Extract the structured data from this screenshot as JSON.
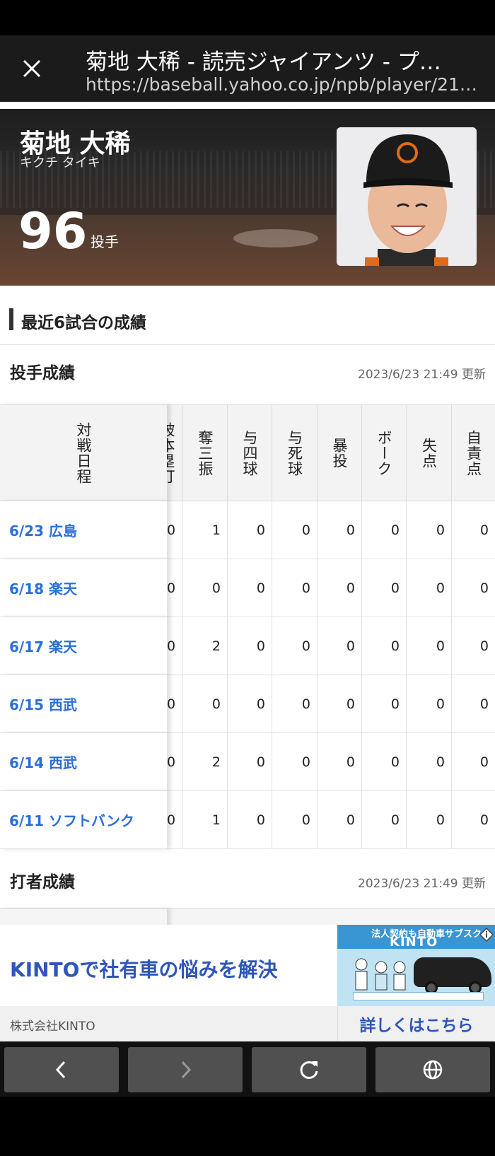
{
  "browser": {
    "title": "菊地 大稀 - 読売ジャイアンツ - プ…",
    "url": "https://baseball.yahoo.co.jp/npb/player/21…"
  },
  "player": {
    "name": "菊地 大稀",
    "kana": "キクチ タイキ",
    "number": "96",
    "position": "投手"
  },
  "section": {
    "title": "最近6試合の成績"
  },
  "pitching": {
    "title": "投手成績",
    "updated": "2023/6/23 21:49 更新",
    "date_header": "対戦日程",
    "partial_header": "被本塁打",
    "columns": [
      "奪三振",
      "与四球",
      "与死球",
      "暴投",
      "ボーク",
      "失点",
      "自責点"
    ],
    "rows": [
      {
        "date": "6/23 広島",
        "partial": "0",
        "values": [
          "1",
          "0",
          "0",
          "0",
          "0",
          "0",
          "0"
        ]
      },
      {
        "date": "6/18 楽天",
        "partial": "0",
        "values": [
          "0",
          "0",
          "0",
          "0",
          "0",
          "0",
          "0"
        ]
      },
      {
        "date": "6/17 楽天",
        "partial": "0",
        "values": [
          "2",
          "0",
          "0",
          "0",
          "0",
          "0",
          "0"
        ]
      },
      {
        "date": "6/15 西武",
        "partial": "0",
        "values": [
          "0",
          "0",
          "0",
          "0",
          "0",
          "0",
          "0"
        ]
      },
      {
        "date": "6/14 西武",
        "partial": "0",
        "values": [
          "2",
          "0",
          "0",
          "0",
          "0",
          "0",
          "0"
        ]
      },
      {
        "date": "6/11 ソフトバンク",
        "partial": "0",
        "values": [
          "1",
          "0",
          "0",
          "0",
          "0",
          "0",
          "0"
        ]
      }
    ]
  },
  "batting": {
    "title": "打者成績",
    "updated": "2023/6/23 21:49 更新"
  },
  "ad": {
    "headline": "KINTOで社有車の悩みを解決",
    "company": "株式会社KINTO",
    "cta": "詳しくはこちら",
    "banner_top": "法人契約も自動車サブスク",
    "banner_brand": "KINTO"
  },
  "icons": {
    "close": "close-icon",
    "back": "chevron-left-icon",
    "forward": "chevron-right-icon",
    "reload": "reload-icon",
    "globe": "globe-icon"
  },
  "colors": {
    "link": "#2a6ed8",
    "ad_text": "#2f56b8",
    "browser_bar": "#1b1b1b",
    "nav_button": "#505050"
  }
}
